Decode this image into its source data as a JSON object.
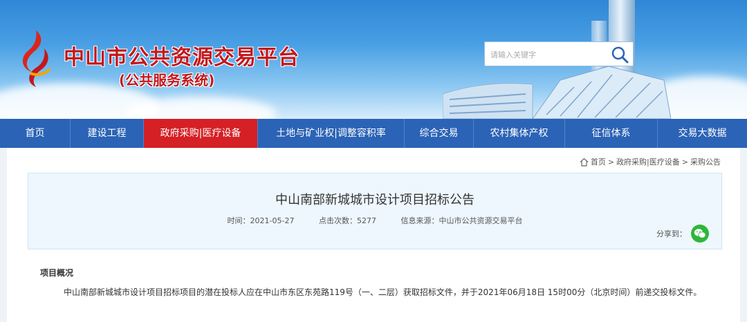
{
  "site": {
    "title": "中山市公共资源交易平台",
    "subtitle": "(公共服务系统)"
  },
  "search": {
    "placeholder": "请输入关键字",
    "icon": "search-icon"
  },
  "nav": {
    "items": [
      {
        "label": "首页"
      },
      {
        "label": "建设工程"
      },
      {
        "label": "政府采购|医疗设备",
        "active": true
      },
      {
        "label": "土地与矿业权|调整容积率"
      },
      {
        "label": "综合交易"
      },
      {
        "label": "农村集体产权"
      },
      {
        "label": "征信体系"
      },
      {
        "label": "交易大数据"
      }
    ]
  },
  "breadcrumb": {
    "home": "首页",
    "sep": ">",
    "level1": "政府采购|医疗设备",
    "level2": "采购公告"
  },
  "article": {
    "title": "中山南部新城城市设计项目招标公告",
    "time": "时间：2021-05-27",
    "clicks": "点击次数：5277",
    "source": "信息来源：中山市公共资源交易平台",
    "share_label": "分享到："
  },
  "body": {
    "section_title": "项目概况",
    "paragraph": "中山南部新城城市设计项目招标项目的潜在投标人应在中山市东区东苑路119号（一、二层）获取招标文件，并于2021年06月18日 15时00分（北京时间）前递交投标文件。"
  },
  "colors": {
    "brand_red": "#c4171c",
    "nav_blue": "#2b63b6",
    "nav_active": "#d52025",
    "wechat_green": "#2fb638"
  }
}
